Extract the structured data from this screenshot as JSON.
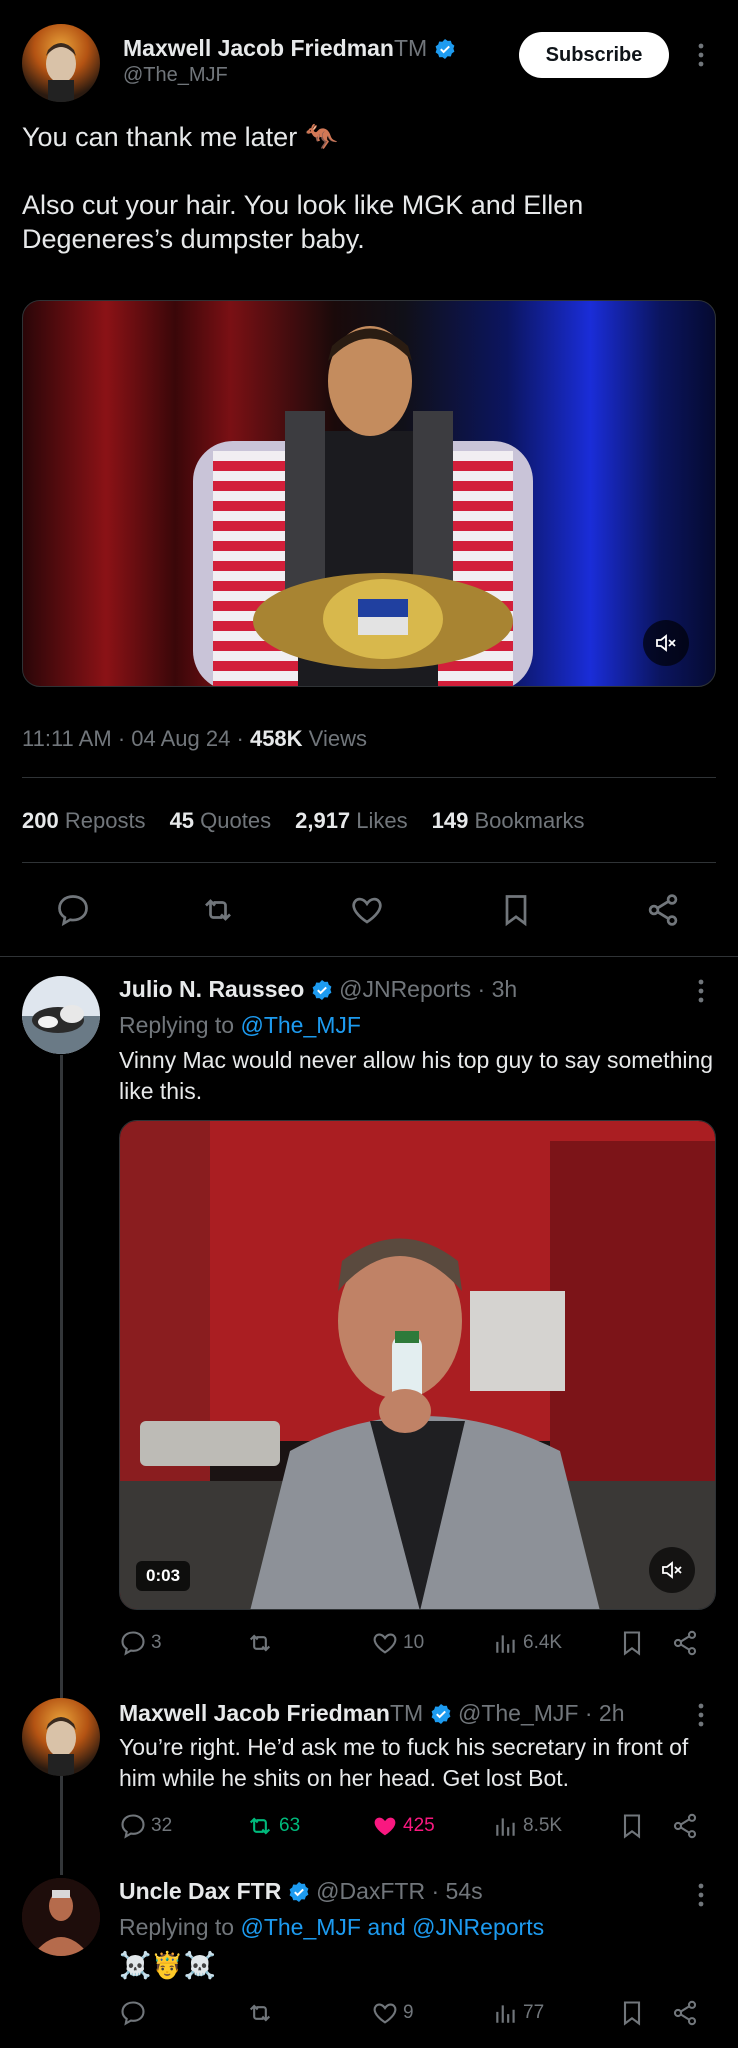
{
  "main_tweet": {
    "author_name": "Maxwell Jacob Friedman",
    "author_tm": "TM",
    "handle": "@The_MJF",
    "subscribe_label": "Subscribe",
    "text_line1": "You can thank me later 🦘",
    "text_line2": "Also cut your hair. You look like MGK and Ellen",
    "text_line3": "Degeneres’s dumpster baby.",
    "time": "11:11 AM",
    "date": "04 Aug 24",
    "views_count": "458K",
    "views_label": "Views",
    "stats": [
      {
        "count": "200",
        "label": "Reposts"
      },
      {
        "count": "45",
        "label": "Quotes"
      },
      {
        "count": "2,917",
        "label": "Likes"
      },
      {
        "count": "149",
        "label": "Bookmarks"
      }
    ]
  },
  "reply1": {
    "author_name": "Julio N. Rausseo",
    "handle": "@JNReports",
    "time": "3h",
    "replying_prefix": "Replying to",
    "replying_to": "@The_MJF",
    "text_line1": "Vinny Mac would never allow his top guy to say something",
    "text_line2": "like this.",
    "video_time": "0:03",
    "replies": "3",
    "likes": "10",
    "views": "6.4K"
  },
  "reply2": {
    "author_name": "Maxwell Jacob Friedman",
    "author_tm": "TM",
    "handle": "@The_MJF",
    "time": "2h",
    "text_line1": "You’re right. He’d ask me to fuck his secretary in front of",
    "text_line2": "him while he shits on her head. Get lost Bot.",
    "replies": "32",
    "reposts": "63",
    "likes": "425",
    "views": "8.5K"
  },
  "reply3": {
    "author_name": "Uncle Dax FTR",
    "handle": "@DaxFTR",
    "time": "54s",
    "replying_prefix": "Replying to",
    "replying_to": "@The_MJF and @JNReports",
    "text": "☠️🤴☠️",
    "likes": "9",
    "views": "77"
  },
  "colors": {
    "background": "#000000",
    "text": "#e7e9ea",
    "muted": "#71767b",
    "accent": "#1d9bf0",
    "repost_active": "#00ba7c",
    "like_active": "#f91880",
    "divider": "#2f3336"
  },
  "icons": [
    "more-icon",
    "verified-icon",
    "mute-icon",
    "reply-icon",
    "repost-icon",
    "like-icon",
    "bookmark-icon",
    "share-icon",
    "views-icon"
  ]
}
